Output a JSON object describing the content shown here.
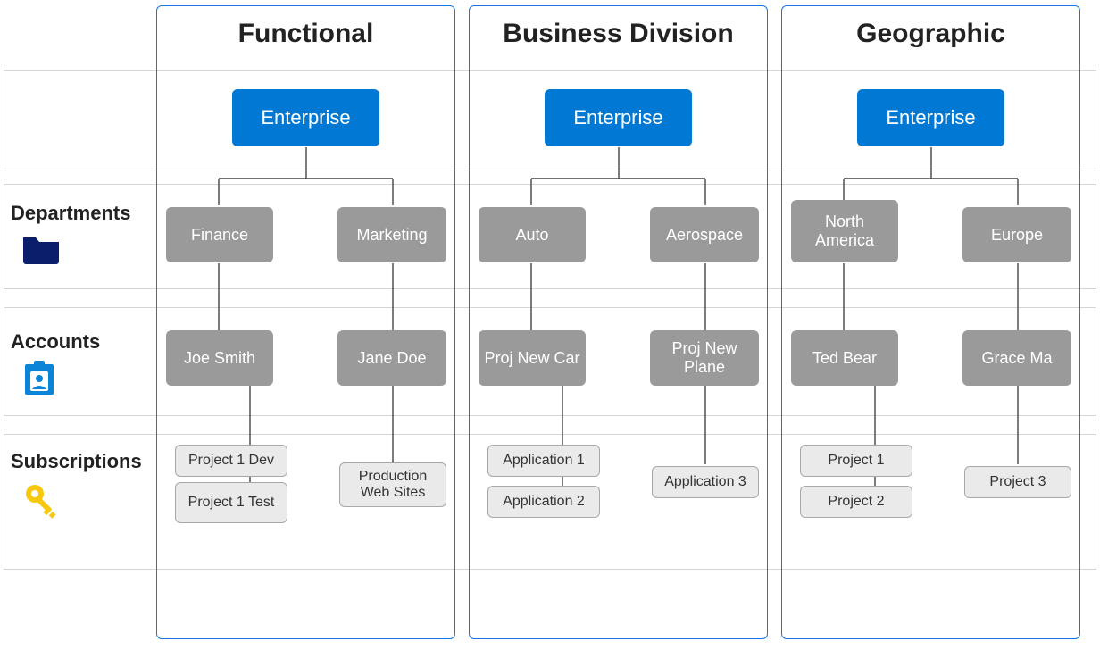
{
  "columns": [
    {
      "id": "functional",
      "title": "Functional",
      "enterprise": "Enterprise",
      "departments": [
        "Finance",
        "Marketing"
      ],
      "accounts": [
        "Joe Smith",
        "Jane Doe"
      ],
      "subscriptions": [
        [
          "Project 1 Dev",
          "Project 1 Test"
        ],
        [
          "Production Web Sites"
        ]
      ]
    },
    {
      "id": "business-division",
      "title": "Business Division",
      "enterprise": "Enterprise",
      "departments": [
        "Auto",
        "Aerospace"
      ],
      "accounts": [
        "Proj New Car",
        "Proj New Plane"
      ],
      "subscriptions": [
        [
          "Application 1",
          "Application 2"
        ],
        [
          "Application 3"
        ]
      ]
    },
    {
      "id": "geographic",
      "title": "Geographic",
      "enterprise": "Enterprise",
      "departments": [
        "North America",
        "Europe"
      ],
      "accounts": [
        "Ted Bear",
        "Grace Ma"
      ],
      "subscriptions": [
        [
          "Project 1",
          "Project 2"
        ],
        [
          "Project 3"
        ]
      ]
    }
  ],
  "rows": {
    "enterprise": "",
    "departments": "Departments",
    "accounts": "Accounts",
    "subscriptions": "Subscriptions"
  }
}
